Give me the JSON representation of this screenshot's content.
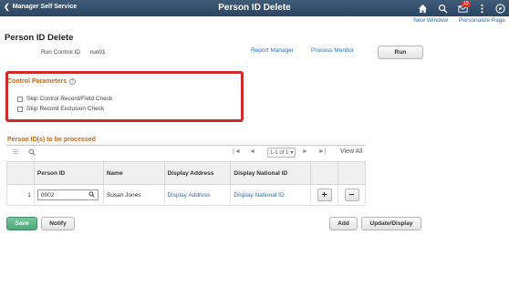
{
  "header": {
    "back_label": "Manager Self Service",
    "title": "Person ID Delete",
    "notifications_count": "10"
  },
  "sublinks": {
    "new_window": "New Window",
    "personalize": "Personalize Page"
  },
  "page_title": "Person ID Delete",
  "run_control": {
    "label": "Run Control ID",
    "value": "run01"
  },
  "links": {
    "report_manager": "Report Manager",
    "process_monitor": "Process Monitor"
  },
  "run_button": "Run",
  "control_params": {
    "title": "Control Parameters",
    "help_glyph": "?",
    "options": [
      {
        "label": "Skip Control Record/Field Check",
        "checked": false
      },
      {
        "label": "Skip Record Exclusion Check",
        "checked": false
      }
    ]
  },
  "grid": {
    "title": "Person ID(s) to be processed",
    "pager": {
      "first": "|◄",
      "prev": "◄",
      "range": "1-1 of 1",
      "next": "►",
      "last": "►|",
      "view_all": "View All"
    },
    "columns": [
      "",
      "Person ID",
      "Name",
      "Display Address",
      "Display National ID",
      "",
      ""
    ],
    "rows": [
      {
        "num": "1",
        "person_id": "0002",
        "name": "Susan Jones",
        "address_link": "Display Address",
        "national_id_link": "Display National ID"
      }
    ],
    "add_row": "+",
    "delete_row": "−"
  },
  "footer": {
    "save": "Save",
    "notify": "Notify",
    "add": "Add",
    "update_display": "Update/Display"
  }
}
